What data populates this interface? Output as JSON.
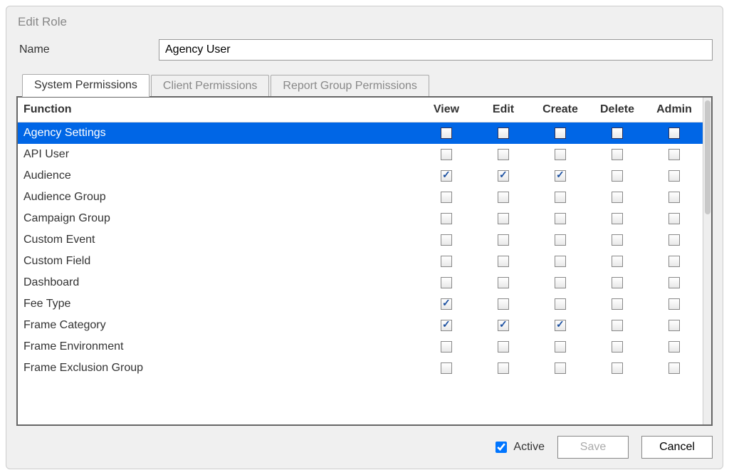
{
  "dialog": {
    "title": "Edit Role"
  },
  "name": {
    "label": "Name",
    "value": "Agency User"
  },
  "tabs": [
    {
      "id": "system",
      "label": "System Permissions",
      "active": true
    },
    {
      "id": "client",
      "label": "Client Permissions",
      "active": false
    },
    {
      "id": "report",
      "label": "Report Group Permissions",
      "active": false
    }
  ],
  "columns": {
    "function": "Function",
    "view": "View",
    "edit": "Edit",
    "create": "Create",
    "delete": "Delete",
    "admin": "Admin"
  },
  "rows": [
    {
      "name": "Agency Settings",
      "selected": true,
      "view": false,
      "edit": false,
      "create": false,
      "delete": false,
      "admin": false
    },
    {
      "name": "API User",
      "selected": false,
      "view": false,
      "edit": false,
      "create": false,
      "delete": false,
      "admin": false
    },
    {
      "name": "Audience",
      "selected": false,
      "view": true,
      "edit": true,
      "create": true,
      "delete": false,
      "admin": false
    },
    {
      "name": "Audience Group",
      "selected": false,
      "view": false,
      "edit": false,
      "create": false,
      "delete": false,
      "admin": false
    },
    {
      "name": "Campaign Group",
      "selected": false,
      "view": false,
      "edit": false,
      "create": false,
      "delete": false,
      "admin": false
    },
    {
      "name": "Custom Event",
      "selected": false,
      "view": false,
      "edit": false,
      "create": false,
      "delete": false,
      "admin": false
    },
    {
      "name": "Custom Field",
      "selected": false,
      "view": false,
      "edit": false,
      "create": false,
      "delete": false,
      "admin": false
    },
    {
      "name": "Dashboard",
      "selected": false,
      "view": false,
      "edit": false,
      "create": false,
      "delete": false,
      "admin": false
    },
    {
      "name": "Fee Type",
      "selected": false,
      "view": true,
      "edit": false,
      "create": false,
      "delete": false,
      "admin": false
    },
    {
      "name": "Frame Category",
      "selected": false,
      "view": true,
      "edit": true,
      "create": true,
      "delete": false,
      "admin": false
    },
    {
      "name": "Frame Environment",
      "selected": false,
      "view": false,
      "edit": false,
      "create": false,
      "delete": false,
      "admin": false
    },
    {
      "name": "Frame Exclusion Group",
      "selected": false,
      "view": false,
      "edit": false,
      "create": false,
      "delete": false,
      "admin": false
    }
  ],
  "footer": {
    "active_label": "Active",
    "active_checked": true,
    "save_label": "Save",
    "save_enabled": false,
    "cancel_label": "Cancel"
  }
}
